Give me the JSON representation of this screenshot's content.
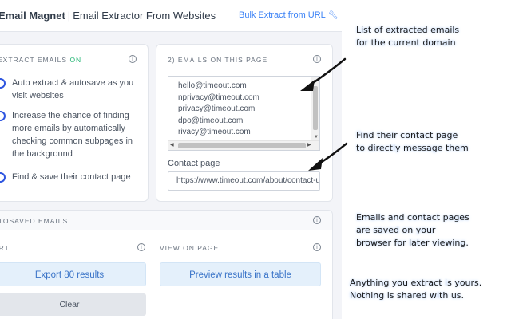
{
  "header": {
    "app_name": "Email Magnet",
    "separator": "|",
    "subtitle": "Email Extractor From Websites",
    "bulk_link": "Bulk Extract from URL"
  },
  "extract_section": {
    "title_prefix": "EXTRACT EMAILS",
    "status": "ON",
    "options": [
      {
        "label": "Auto extract & autosave as you visit websites",
        "enabled": true
      },
      {
        "label": "Increase the chance of finding more emails by automatically checking common subpages in the background",
        "enabled": true
      },
      {
        "label": "Find & save their contact page",
        "enabled": true
      }
    ]
  },
  "emails_section": {
    "title": "2) EMAILS ON THIS PAGE",
    "emails": [
      "hello@timeout.com",
      "nprivacy@timeout.com",
      "privacy@timeout.com",
      "dpo@timeout.com",
      "rivacy@timeout.com"
    ],
    "contact_label": "Contact page",
    "contact_value": "https://www.timeout.com/about/contact-us"
  },
  "autosaved_section": {
    "title": "AUTOSAVED EMAILS",
    "export_label": "ORT",
    "view_label": "VIEW ON PAGE",
    "export_button": "Export 80 results",
    "preview_button": "Preview results in a table",
    "clear_button": "Clear"
  },
  "annotations": [
    {
      "lines": [
        "List of extracted emails",
        "for the current domain"
      ]
    },
    {
      "lines": [
        "Find their contact page",
        "to directly message them"
      ]
    },
    {
      "lines": [
        "Emails and contact pages",
        "are saved on your",
        "browser for later viewing."
      ]
    },
    {
      "lines": [
        "Anything you extract is yours.",
        "Nothing is shared with us."
      ]
    }
  ],
  "colors": {
    "accent": "#2f56e0",
    "on_status": "#22b573",
    "link": "#3b82f6",
    "button_bg": "#e4f0fb",
    "panel_bg": "#f3f4f8"
  }
}
